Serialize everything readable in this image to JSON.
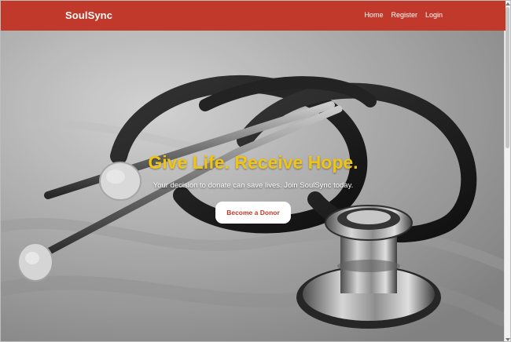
{
  "navbar": {
    "brand": "SoulSync",
    "links": [
      "Home",
      "Register",
      "Login"
    ],
    "background_color": "#c0392b"
  },
  "hero": {
    "headline": "Give Life. Receive Hope.",
    "subtext": "Your decision to donate can save lives. Join SoulSync today.",
    "cta_label": "Become a Donor",
    "headline_color": "#f1c40f",
    "background_image": "stethoscope-photo"
  }
}
